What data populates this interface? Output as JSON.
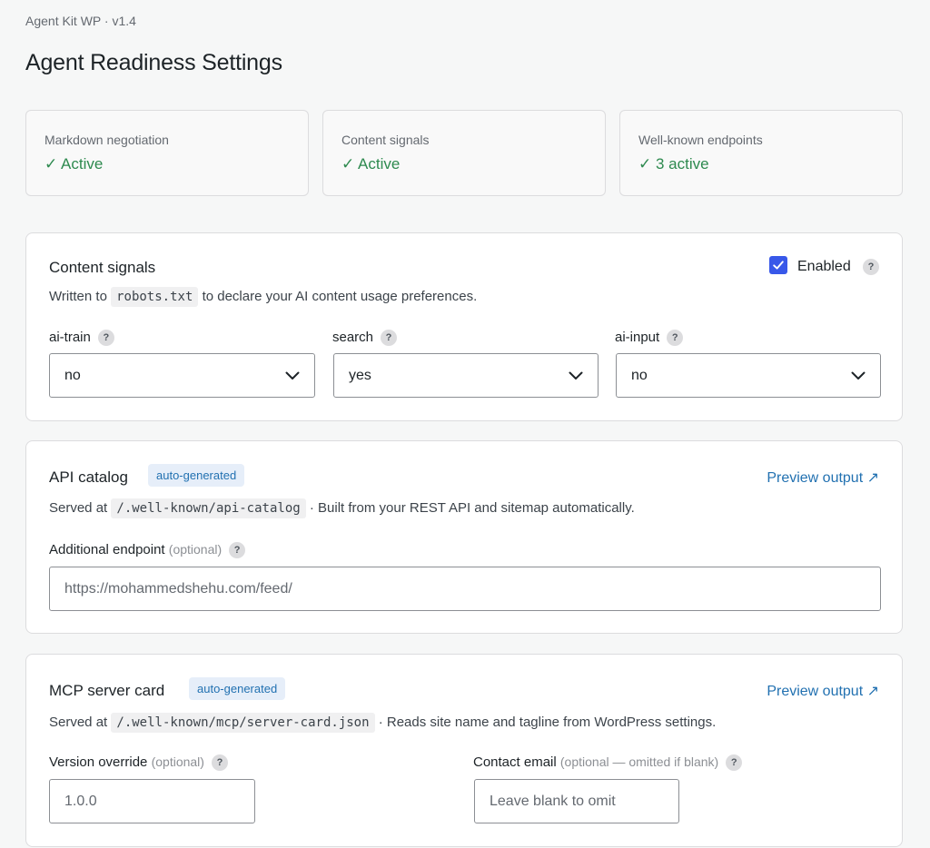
{
  "header": {
    "breadcrumb": "Agent Kit WP · v1.4",
    "title": "Agent Readiness Settings"
  },
  "stats": [
    {
      "label": "Markdown negotiation",
      "value": "✓ Active"
    },
    {
      "label": "Content signals",
      "value": "✓ Active"
    },
    {
      "label": "Well-known endpoints",
      "value": "✓ 3 active"
    }
  ],
  "content_signals": {
    "title": "Content signals",
    "enabled_label": "Enabled",
    "enabled": true,
    "desc_prefix": "Written to",
    "desc_code": "robots.txt",
    "desc_suffix": "to declare your AI content usage preferences.",
    "fields": [
      {
        "label": "ai-train",
        "value": "no"
      },
      {
        "label": "search",
        "value": "yes"
      },
      {
        "label": "ai-input",
        "value": "no"
      }
    ]
  },
  "api_catalog": {
    "title": "API catalog",
    "badge": "auto-generated",
    "preview_link": "Preview output ↗",
    "desc_prefix": "Served at",
    "desc_code": "/.well-known/api-catalog",
    "desc_suffix": "· Built from your REST API and sitemap automatically.",
    "field_label": "Additional endpoint",
    "field_optional": "(optional)",
    "field_value": "https://mohammedshehu.com/feed/"
  },
  "mcp_card": {
    "title": "MCP server card",
    "badge": "auto-generated",
    "preview_link": "Preview output ↗",
    "desc_prefix": "Served at",
    "desc_code": "/.well-known/mcp/server-card.json",
    "desc_suffix": "· Reads site name and tagline from WordPress settings.",
    "version_label": "Version override",
    "version_optional": "(optional)",
    "version_value": "1.0.0",
    "email_label": "Contact email",
    "email_optional": "(optional — omitted if blank)",
    "email_placeholder": "Leave blank to omit"
  },
  "help_glyph": "?",
  "colors": {
    "accent": "#2271b1",
    "success": "#2e8a4f",
    "checkbox": "#3858e9"
  }
}
